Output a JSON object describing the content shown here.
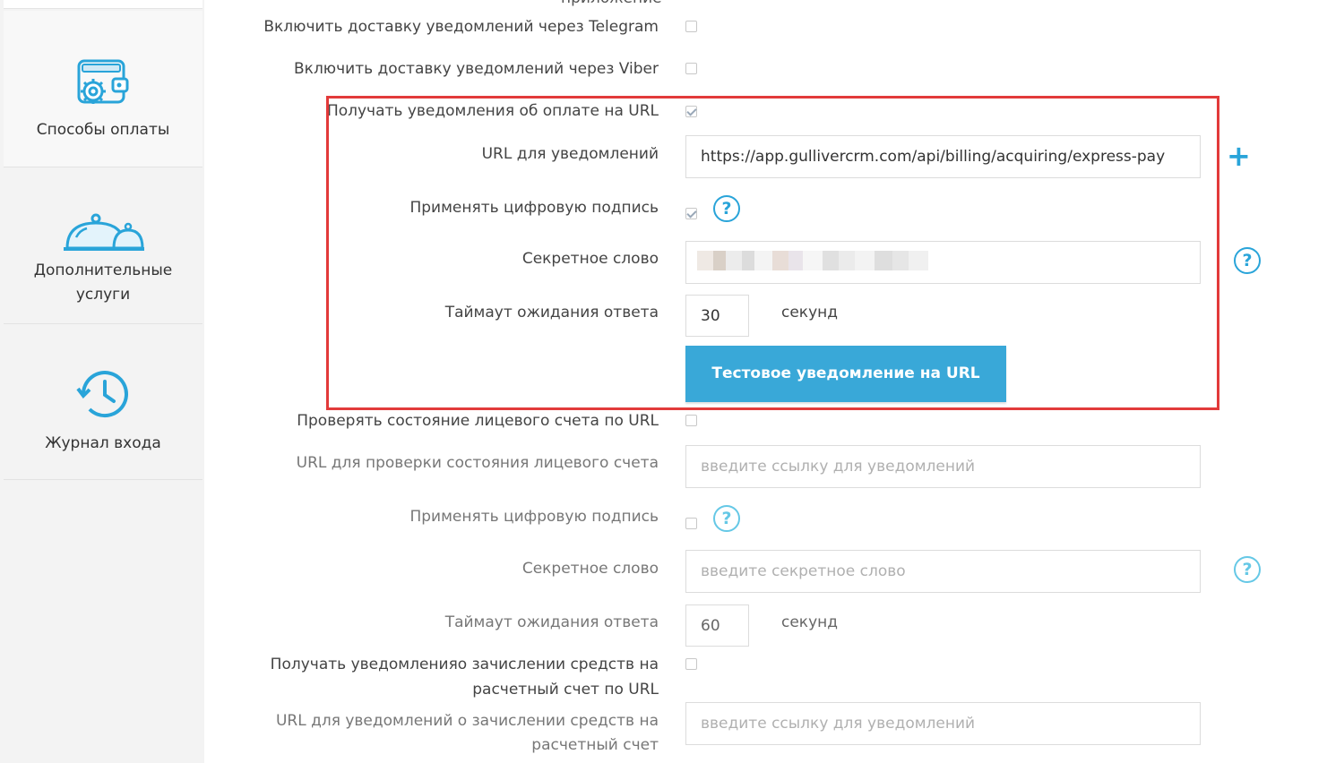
{
  "sidebar": {
    "items": [
      {
        "label": "Способы оплаты",
        "icon": "wallet-gear-icon"
      },
      {
        "label": "Дополнительные услуги",
        "icon": "service-bell-icon"
      },
      {
        "label": "Журнал входа",
        "icon": "history-clock-icon"
      }
    ]
  },
  "form": {
    "cut_label": "приложение",
    "telegram_label": "Включить доставку уведомлений через Telegram",
    "viber_label": "Включить доставку уведомлений через Viber",
    "pay_notify_label": "Получать уведомления об оплате на URL",
    "pay_notify_checked": true,
    "url_label": "URL для уведомлений",
    "url_value": "https://app.gullivercrm.com/api/billing/acquiring/express-pay",
    "sign_label": "Применять цифровую подпись",
    "sign_checked": true,
    "secret_label": "Секретное слово",
    "timeout_label": "Таймаут ожидания ответа",
    "timeout_value": "30",
    "unit_label": "секунд",
    "test_button": "Тестовое уведомление на URL",
    "check_account_label": "Проверять состояние лицевого счета по URL",
    "check_url_label": "URL для проверки состояния лицевого счета",
    "check_url_placeholder": "введите ссылку для уведомлений",
    "sign2_label": "Применять цифровую подпись",
    "secret2_label": "Секретное слово",
    "secret2_placeholder": "введите секретное слово",
    "timeout2_label": "Таймаут ожидания ответа",
    "timeout2_value": "60",
    "unit2_label": "секунд",
    "credit_notify_label_1": "Получать уведомленияо зачислении средств на",
    "credit_notify_label_2": "расчетный счет по URL",
    "credit_url_label_1": "URL для уведомлений о зачислении средств на",
    "credit_url_label_2": "расчетный счет",
    "credit_url_placeholder": "введите ссылку для уведомлений",
    "help_symbol": "?",
    "plus_symbol": "+"
  },
  "colors": {
    "accent": "#29a4d9",
    "button": "#39a8d8",
    "highlight_border": "#e23a3a"
  }
}
